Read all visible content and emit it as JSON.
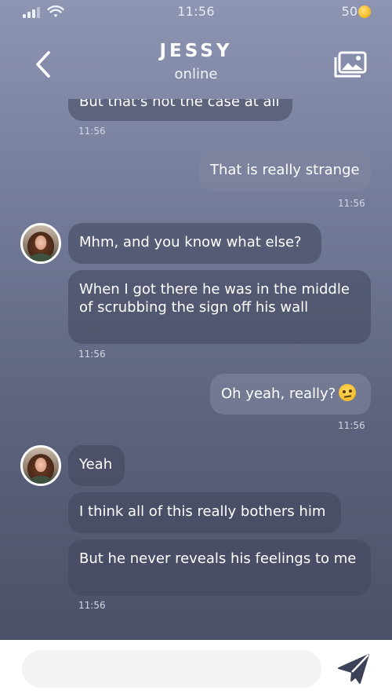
{
  "status_bar": {
    "time": "11:56",
    "coins": "50",
    "icons": [
      "signal-icon",
      "wifi-icon",
      "coin-icon"
    ]
  },
  "header": {
    "name": "JESSY",
    "status": "online",
    "icons": [
      "back-arrow-icon",
      "gallery-icon"
    ]
  },
  "messages": [
    {
      "side": "incoming",
      "text": "But that's not the case at all"
    },
    {
      "side": "time",
      "text": "11:56"
    },
    {
      "side": "outgoing",
      "text": "That is really strange"
    },
    {
      "side": "time",
      "text": "11:56"
    },
    {
      "side": "incoming",
      "text": "Mhm, and you know what else?"
    },
    {
      "side": "incoming",
      "text": "When I got there he was in the middle of scrubbing the sign off his wall"
    },
    {
      "side": "time",
      "text": "11:56"
    },
    {
      "side": "outgoing",
      "text": "Oh yeah, really?",
      "emoji": "raised-eyebrow-emoji"
    },
    {
      "side": "time",
      "text": "11:56"
    },
    {
      "side": "incoming",
      "text": "Yeah"
    },
    {
      "side": "incoming",
      "text": "I think all of this really bothers him"
    },
    {
      "side": "incoming",
      "text": "But he never reveals his feelings to me"
    },
    {
      "side": "time",
      "text": "11:56"
    }
  ],
  "composer": {
    "placeholder": "",
    "value": "",
    "send_icon": "send-icon"
  },
  "colors": {
    "background_top": "#8e95b2",
    "background_bottom": "#4c5169",
    "bubble_text": "#ffffff",
    "send_icon": "#3c4257"
  }
}
